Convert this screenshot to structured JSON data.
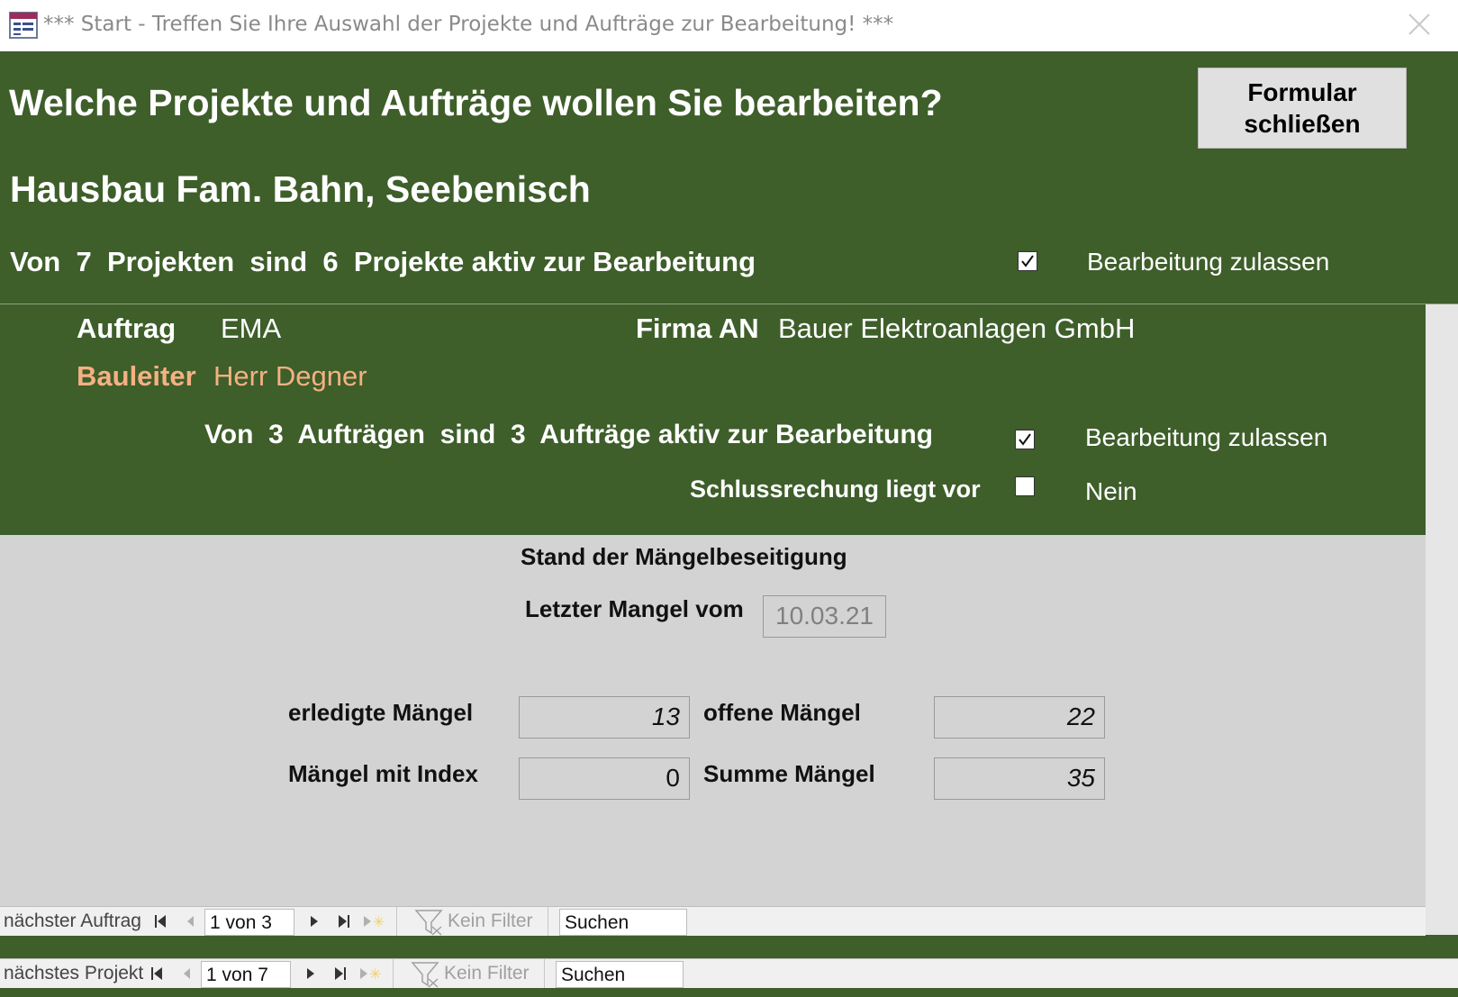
{
  "window": {
    "title": "*** Start - Treffen Sie Ihre Auswahl der Projekte und Aufträge zur Bearbeitung! ***"
  },
  "header": {
    "heading": "Welche Projekte und Aufträge wollen Sie bearbeiten?",
    "project_name": "Hausbau Fam. Bahn, Seebenisch",
    "projects_summary": "Von  7  Projekten  sind  6  Projekte aktiv zur Bearbeitung",
    "close_button_line1": "Formular",
    "close_button_line2": "schließen",
    "allow_edit_checked": true,
    "allow_edit_label": "Bearbeitung zulassen"
  },
  "order": {
    "auftrag_label": "Auftrag",
    "auftrag_value": "EMA",
    "firma_label": "Firma AN",
    "firma_value": "Bauer Elektroanlagen GmbH",
    "bauleiter_label": "Bauleiter",
    "bauleiter_value": "Herr Degner",
    "orders_summary": "Von  3  Aufträgen  sind  3  Aufträge aktiv zur Bearbeitung",
    "allow_edit_checked": true,
    "allow_edit_label": "Bearbeitung zulassen",
    "final_invoice_label": "Schlussrechung liegt vor",
    "final_invoice_checked": false,
    "final_invoice_value": "Nein"
  },
  "defects": {
    "section_title": "Stand der Mängelbeseitigung",
    "last_defect_label": "Letzter Mangel vom",
    "last_defect_date": "10.03.21",
    "done_label": "erledigte Mängel",
    "done_value": "13",
    "open_label": "offene Mängel",
    "open_value": "22",
    "index_label": "Mängel mit Index",
    "index_value": "0",
    "sum_label": "Summe Mängel",
    "sum_value": "35"
  },
  "nav_order": {
    "label": "nächster Auftrag",
    "record": "1 von 3",
    "filter": "Kein Filter",
    "search": "Suchen"
  },
  "nav_project": {
    "label": "nächstes Projekt",
    "record": "1 von 7",
    "filter": "Kein Filter",
    "search": "Suchen"
  },
  "colors": {
    "form_green": "#3e5e2a",
    "bauleiter_accent": "#f4b183",
    "panel_grey": "#d4d3d4"
  }
}
